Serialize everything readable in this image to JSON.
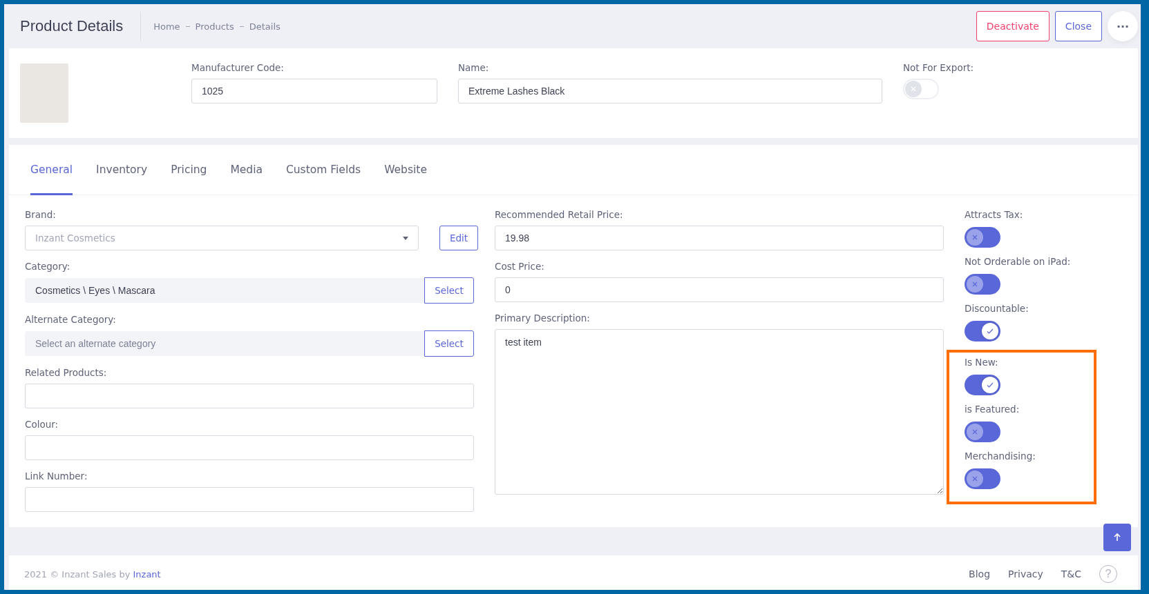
{
  "header": {
    "title": "Product Details",
    "breadcrumbs": [
      "Home",
      "Products",
      "Details"
    ],
    "buttons": [
      {
        "label": "Deactivate",
        "kind": "danger"
      },
      {
        "label": "Close",
        "kind": "primary"
      },
      {
        "label": "···",
        "kind": "more"
      }
    ]
  },
  "summary": {
    "fields": [
      {
        "label": "Manufacturer Code:",
        "value": "1025"
      },
      {
        "label": "Name:",
        "value": "Extreme Lashes Black"
      }
    ],
    "toggle": {
      "label": "Not For Export:",
      "on": false,
      "disabled": true
    }
  },
  "tabs": [
    {
      "label": "General",
      "selected": true
    },
    {
      "label": "Inventory",
      "selected": false
    },
    {
      "label": "Pricing",
      "selected": false
    },
    {
      "label": "Media",
      "selected": false
    },
    {
      "label": "Custom Fields",
      "selected": false
    },
    {
      "label": "Website",
      "selected": false
    }
  ],
  "left_fields": [
    {
      "label": "Brand:",
      "kind": "select",
      "value": "Inzant Cosmetics",
      "button": "Edit"
    },
    {
      "label": "Category:",
      "kind": "picker",
      "value": "Cosmetics \\ Eyes \\ Mascara",
      "button": "Select"
    },
    {
      "label": "Alternate Category:",
      "kind": "picker",
      "placeholder": "Select an alternate category",
      "button": "Select"
    },
    {
      "label": "Related Products:",
      "kind": "text"
    },
    {
      "label": "Colour:",
      "kind": "text"
    },
    {
      "label": "Link Number:",
      "kind": "text"
    }
  ],
  "middle_fields": [
    {
      "label": "Recommended Retail Price:",
      "kind": "text",
      "value": "19.98"
    },
    {
      "label": "Cost Price:",
      "kind": "text",
      "value": "0"
    },
    {
      "label": "Primary Description:",
      "kind": "textarea",
      "value": "test item"
    }
  ],
  "toggles": [
    {
      "label": "Attracts Tax:",
      "on": false
    },
    {
      "label": "Not Orderable on iPad:",
      "on": false
    },
    {
      "label": "Discountable:",
      "on": true
    }
  ],
  "highlighted_toggles": [
    {
      "label": "Is New:",
      "on": true
    },
    {
      "label": "is Featured:",
      "on": false
    },
    {
      "label": "Merchandising:",
      "on": false
    }
  ],
  "footer": {
    "year": "2021",
    "copyright": "©",
    "text": "Inzant Sales by",
    "link": "Inzant",
    "links": [
      "Blog",
      "Privacy",
      "T&C"
    ],
    "help": "?"
  }
}
